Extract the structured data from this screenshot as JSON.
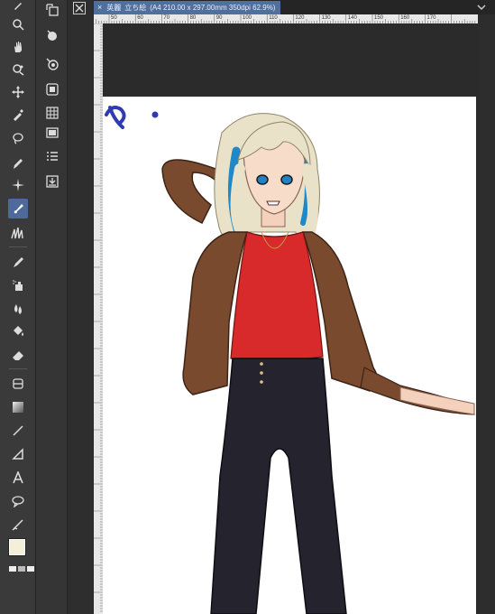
{
  "tab": {
    "close_glyph": "×",
    "name": "英麗",
    "document_label": "立ち絵",
    "info": "(A4 210.00 x 297.00mm 350dpi 62.9%)"
  },
  "ruler": {
    "ticks": [
      "50",
      "60",
      "70",
      "80",
      "90",
      "100",
      "110",
      "120",
      "130",
      "140",
      "150",
      "160",
      "170"
    ]
  },
  "canvas": {
    "sketch_text": "め・"
  },
  "colors": {
    "toolbar": "#3a3a3a",
    "active_tool": "#4d6a9a",
    "main_color": "#f4efd9",
    "sub_color": "#f3d6dc",
    "tab_active": "#4f6f9c"
  },
  "tools": [
    "zoom-icon",
    "hand-icon",
    "rotate-icon",
    "move-icon",
    "eyedropper-icon",
    "lasso-icon",
    "pen-icon",
    "sparkle-icon",
    "brush-icon",
    "grass-icon",
    "pencil-icon",
    "airbrush-icon",
    "blend-icon",
    "fill-icon",
    "eraser-icon",
    "layer-icon",
    "gradient-icon",
    "line-icon",
    "figure-icon",
    "text-icon",
    "balloon-icon",
    "correction-icon"
  ],
  "subtools": [
    "layer-move-icon",
    "layer-rotate-icon",
    "layer-scale-icon",
    "view-icon",
    "grid-icon",
    "frame-icon",
    "list-icon",
    "import-icon"
  ]
}
